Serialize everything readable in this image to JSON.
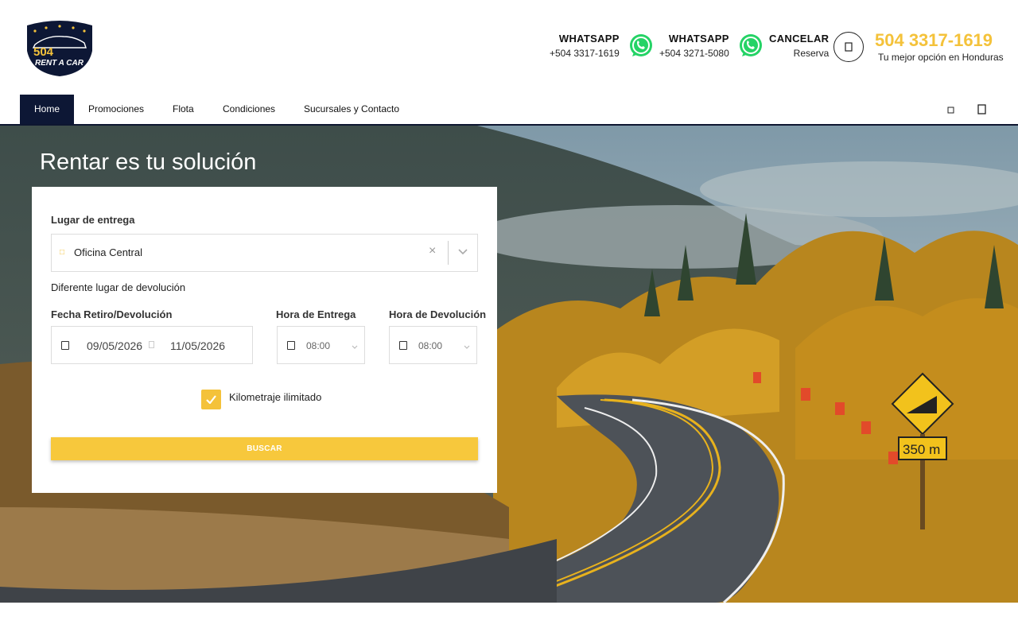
{
  "brand": {
    "logo_line1": "504",
    "logo_line2": "RENT A CAR"
  },
  "header": {
    "contacts": [
      {
        "title": "WHATSAPP",
        "number": "+504 3317-1619",
        "icon": "whatsapp-icon"
      },
      {
        "title": "WHATSAPP",
        "number": "+504 3271-5080",
        "icon": "whatsapp-icon"
      }
    ],
    "cancel": {
      "title": "CANCELAR",
      "sub": "Reserva",
      "icon": "square-icon"
    },
    "phone": "504 3317-1619",
    "tagline": "Tu mejor opción en Honduras"
  },
  "nav": {
    "items": [
      "Home",
      "Promociones",
      "Flota",
      "Condiciones",
      "Sucursales y Contacto"
    ],
    "active": "Home"
  },
  "hero": {
    "title": "Rentar es tu solución"
  },
  "form": {
    "place_label": "Lugar de entrega",
    "place_value": "Oficina Central",
    "clear_symbol": "×",
    "different_return": "Diferente lugar de devolución",
    "date_label": "Fecha Retiro/Devolución",
    "pickup_date": "09/05/2026",
    "return_date": "11/05/2026",
    "pickup_time_label": "Hora de Entrega",
    "pickup_time": "08:00",
    "return_time_label": "Hora de Devolución",
    "return_time": "08:00",
    "unlimited_km_label": "Kilometraje ilimitado",
    "unlimited_km_checked": true,
    "search_button": "BUSCAR"
  },
  "sign": {
    "distance": "350 m"
  },
  "colors": {
    "accent": "#f4c23a",
    "navy": "#0d1735",
    "whatsapp": "#25d366"
  }
}
